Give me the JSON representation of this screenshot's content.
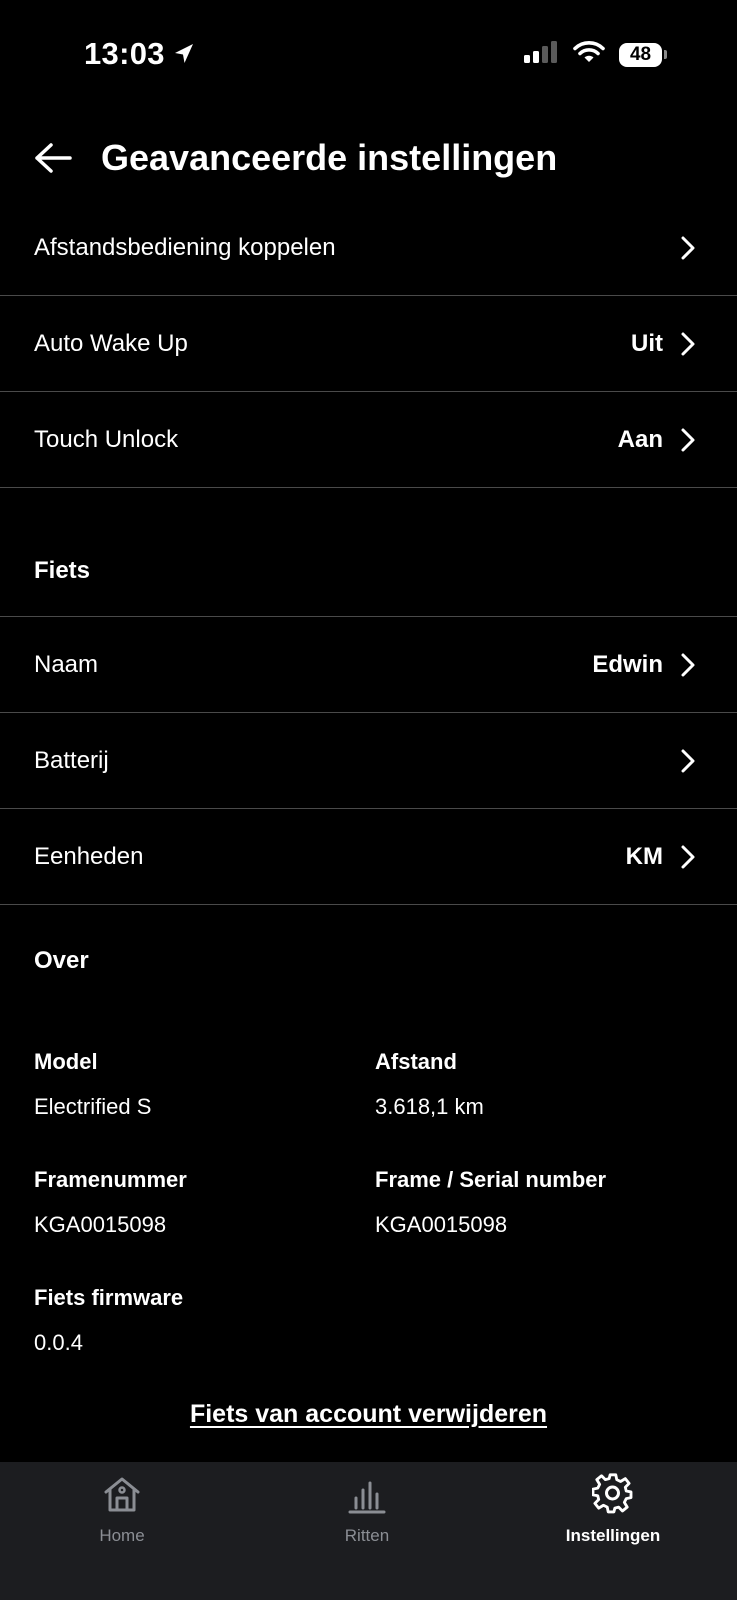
{
  "status_bar": {
    "time": "13:03",
    "battery": "48"
  },
  "header": {
    "title": "Geavanceerde instellingen"
  },
  "settings_rows": [
    {
      "label": "Afstandsbediening koppelen",
      "value": ""
    },
    {
      "label": "Auto Wake Up",
      "value": "Uit"
    },
    {
      "label": "Touch Unlock",
      "value": "Aan"
    }
  ],
  "bike_section": {
    "title": "Fiets",
    "rows": [
      {
        "label": "Naam",
        "value": "Edwin"
      },
      {
        "label": "Batterij",
        "value": ""
      },
      {
        "label": "Eenheden",
        "value": "KM"
      }
    ]
  },
  "about_section": {
    "title": "Over",
    "model_label": "Model",
    "model_value": "Electrified S",
    "distance_label": "Afstand",
    "distance_value": "3.618,1 km",
    "frame_label": "Framenummer",
    "frame_value": "KGA0015098",
    "serial_label": "Frame / Serial number",
    "serial_value": "KGA0015098",
    "firmware_label": "Fiets firmware",
    "firmware_value": "0.0.4"
  },
  "remove_link": "Fiets van account verwijderen",
  "tabs": [
    {
      "label": "Home",
      "icon": "home-icon",
      "active": false
    },
    {
      "label": "Ritten",
      "icon": "bar-chart-icon",
      "active": false
    },
    {
      "label": "Instellingen",
      "icon": "gear-icon",
      "active": true
    }
  ],
  "colors": {
    "background": "#000000",
    "tab_bar": "#1c1d20",
    "divider": "#4a4a4a",
    "inactive_tab": "#8b8e94",
    "active_tab": "#ffffff"
  }
}
